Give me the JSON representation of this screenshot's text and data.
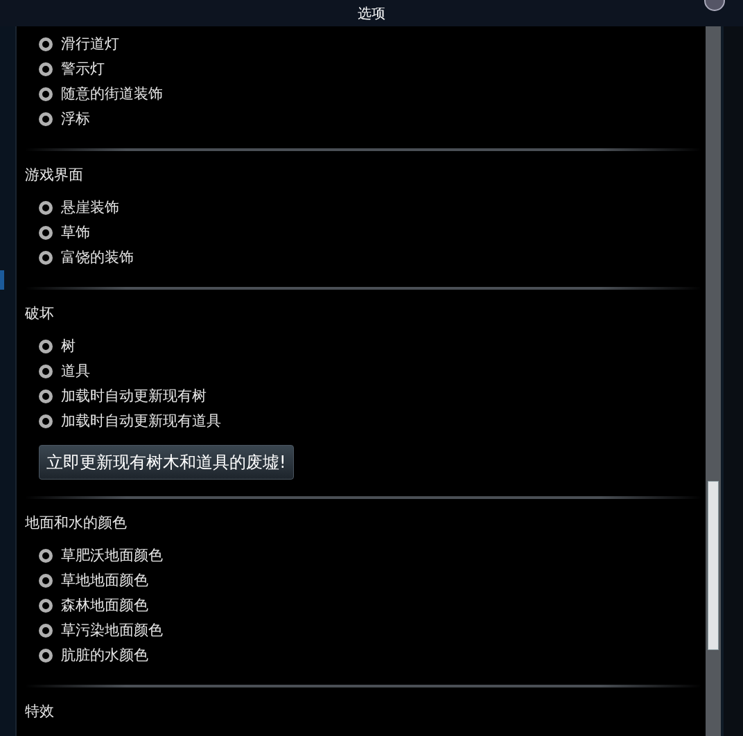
{
  "window": {
    "title": "选项"
  },
  "sections": [
    {
      "options": [
        {
          "label": "滑行道灯",
          "checked": true
        },
        {
          "label": "警示灯",
          "checked": true
        },
        {
          "label": "随意的街道装饰",
          "checked": true
        },
        {
          "label": "浮标",
          "checked": true
        }
      ]
    },
    {
      "title": "游戏界面",
      "options": [
        {
          "label": "悬崖装饰",
          "checked": true
        },
        {
          "label": "草饰",
          "checked": true
        },
        {
          "label": "富饶的装饰",
          "checked": true
        }
      ]
    },
    {
      "title": "破坏",
      "options": [
        {
          "label": "树",
          "checked": true
        },
        {
          "label": "道具",
          "checked": true
        },
        {
          "label": "加载时自动更新现有树",
          "checked": true
        },
        {
          "label": "加载时自动更新现有道具",
          "checked": true
        }
      ],
      "button": "立即更新现有树木和道具的废墟!"
    },
    {
      "title": "地面和水的颜色",
      "options": [
        {
          "label": "草肥沃地面颜色",
          "checked": true
        },
        {
          "label": "草地地面颜色",
          "checked": true
        },
        {
          "label": "森林地面颜色",
          "checked": true
        },
        {
          "label": "草污染地面颜色",
          "checked": true
        },
        {
          "label": "肮脏的水颜色",
          "checked": true
        }
      ]
    },
    {
      "title": "特效"
    }
  ]
}
